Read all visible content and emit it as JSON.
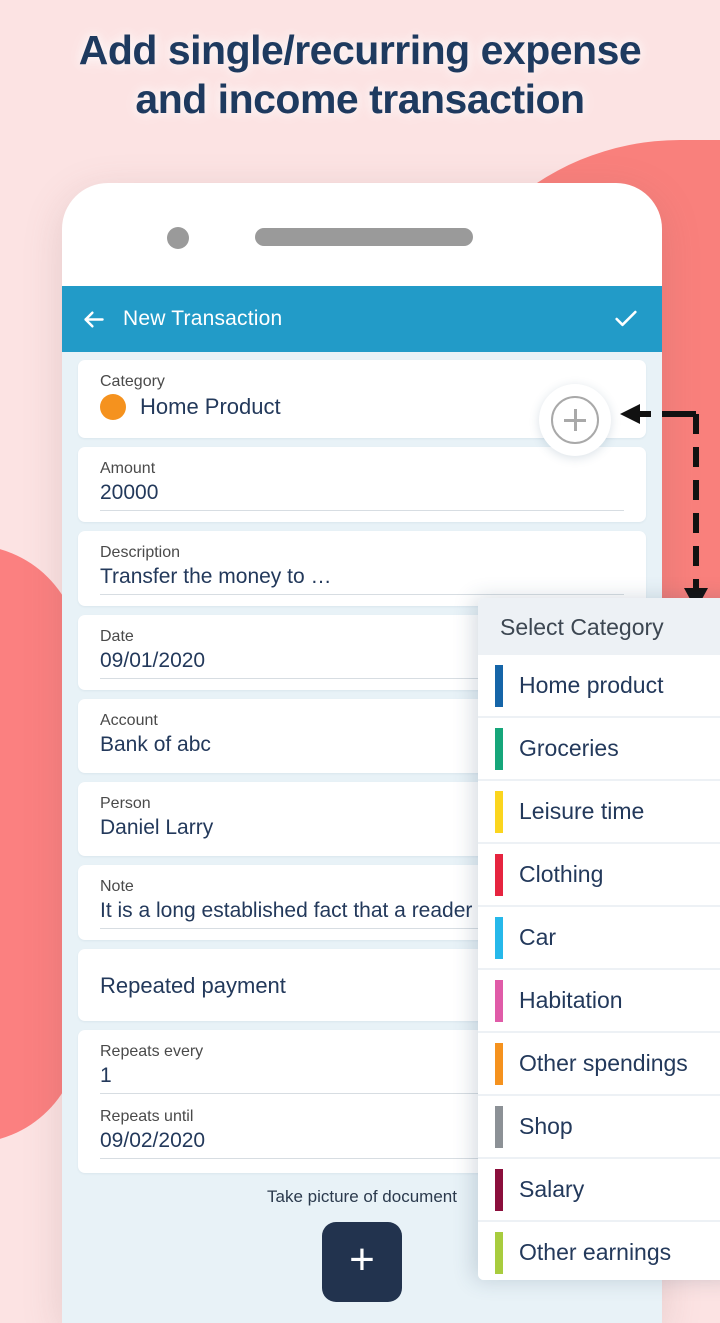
{
  "page": {
    "headline_line1": "Add single/recurring expense",
    "headline_line2": "and income transaction",
    "background_color": "#FCE3E3",
    "accent_coral": "#F9807C"
  },
  "app": {
    "appbar": {
      "title": "New Transaction",
      "back_icon": "arrow-left-icon",
      "confirm_icon": "check-icon",
      "background_color": "#229BC8"
    },
    "add_button": {
      "icon": "plus-circle-icon"
    },
    "fields": [
      {
        "label": "Category",
        "value": "Home Product",
        "dot_color": "#F5921E",
        "type": "category"
      },
      {
        "label": "Amount",
        "value": "20000",
        "type": "text"
      },
      {
        "label": "Description",
        "value": "Transfer the money to …",
        "type": "text"
      },
      {
        "label": "Date",
        "value": "09/01/2020",
        "type": "text"
      },
      {
        "label": "Account",
        "value": "Bank of abc",
        "type": "text"
      },
      {
        "label": "Person",
        "value": "Daniel Larry",
        "type": "text"
      },
      {
        "label": "Note",
        "value": "It is a long established fact that a reader …",
        "type": "text"
      }
    ],
    "repeated_payment": {
      "title": "Repeated payment",
      "repeats_every_label": "Repeats every",
      "repeats_every_value": "1",
      "repeats_until_label": "Repeats until",
      "repeats_until_value": "09/02/2020"
    },
    "document": {
      "label": "Take picture of document",
      "button_icon": "plus-icon",
      "button_label": "+"
    }
  },
  "dropdown": {
    "title": "Select Category",
    "items": [
      {
        "label": "Home product",
        "color": "#1565A8"
      },
      {
        "label": "Groceries",
        "color": "#16A67A"
      },
      {
        "label": "Leisure time",
        "color": "#FBD51E"
      },
      {
        "label": "Clothing",
        "color": "#E6243F"
      },
      {
        "label": "Car",
        "color": "#26B8EA"
      },
      {
        "label": "Habitation",
        "color": "#E05BA8"
      },
      {
        "label": "Other spendings",
        "color": "#F5921E"
      },
      {
        "label": "Shop",
        "color": "#8C9196"
      },
      {
        "label": "Salary",
        "color": "#8B0F3C"
      },
      {
        "label": "Other earnings",
        "color": "#A8CC3E"
      }
    ]
  },
  "annotation": {
    "connector_icon": "dashed-arrow-connector",
    "color": "#111111"
  }
}
